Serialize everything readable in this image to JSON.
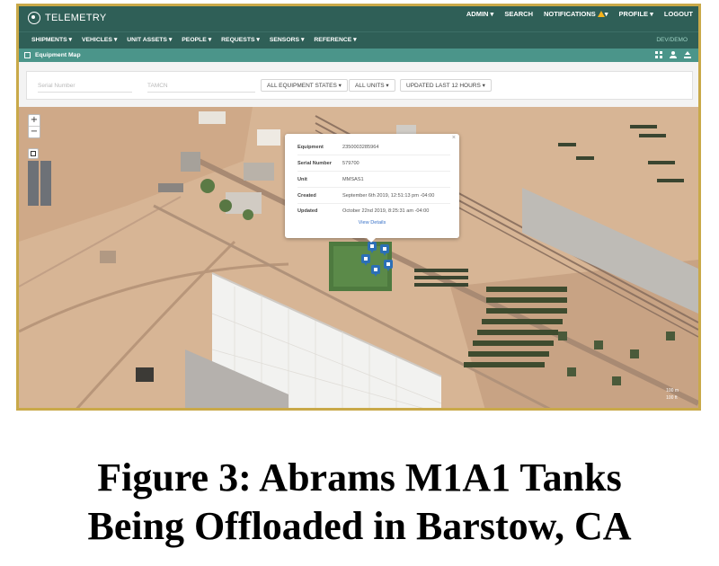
{
  "app": {
    "title": "TELEMETRY"
  },
  "top_links": {
    "admin": "ADMIN ▾",
    "search": "SEARCH",
    "notifications": "NOTIFICATIONS",
    "profile": "PROFILE ▾",
    "logout": "LOGOUT"
  },
  "nav": {
    "items": [
      {
        "label": "SHIPMENTS ▾"
      },
      {
        "label": "VEHICLES ▾"
      },
      {
        "label": "UNIT ASSETS ▾"
      },
      {
        "label": "PEOPLE ▾"
      },
      {
        "label": "REQUESTS ▾"
      },
      {
        "label": "SENSORS ▾"
      },
      {
        "label": "REFERENCE ▾"
      }
    ],
    "environment": "DEV/DEMO"
  },
  "panel": {
    "title": "Equipment Map"
  },
  "filters": {
    "serial_placeholder": "Serial Number",
    "tamcn_placeholder": "TAMCN",
    "states": "ALL EQUIPMENT STATES ▾",
    "units": "ALL UNITS ▾",
    "updated": "UPDATED LAST 12 HOURS ▾"
  },
  "map": {
    "zoom_in": "+",
    "zoom_out": "−",
    "scale_m": "100 m",
    "scale_ft": "100 ft"
  },
  "popup": {
    "rows": [
      {
        "label": "Equipment",
        "value": "2350003285964"
      },
      {
        "label": "Serial Number",
        "value": "579700"
      },
      {
        "label": "Unit",
        "value": "MMSAS1"
      },
      {
        "label": "Created",
        "value": "September 6th 2019, 12:51:13 pm -04:00"
      },
      {
        "label": "Updated",
        "value": "October 22nd 2019, 8:25:31 am -04:00"
      }
    ],
    "link": "View Details",
    "close": "×"
  },
  "caption": {
    "line1": "Figure 3: Abrams M1A1 Tanks",
    "line2": "Being Offloaded in Barstow, CA"
  },
  "colors": {
    "header": "#2f5f57",
    "panel": "#4b958a",
    "border": "#c9a949",
    "pin": "#2c6fb6"
  }
}
